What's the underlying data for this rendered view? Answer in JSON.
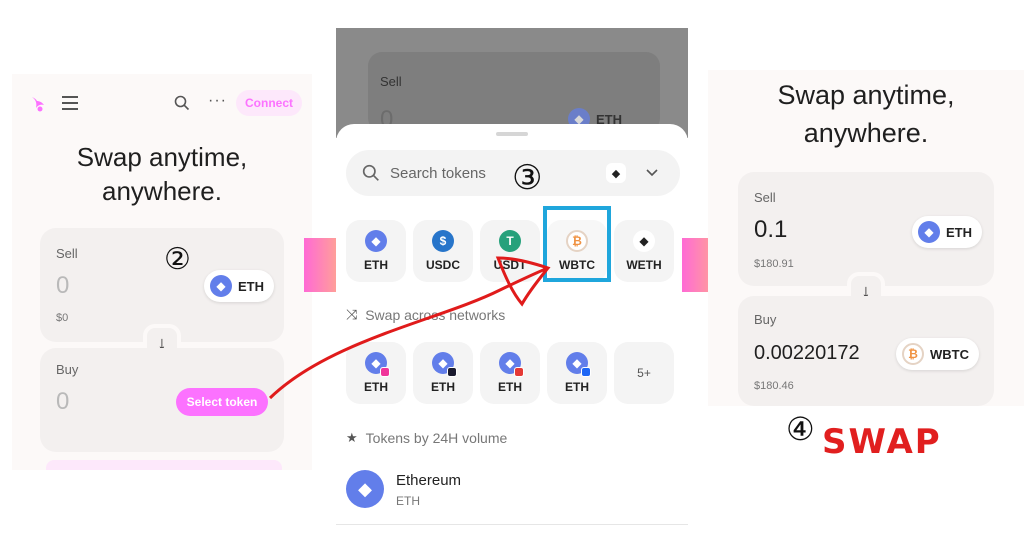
{
  "panel1": {
    "connect_label": "Connect",
    "hero_line1": "Swap anytime,",
    "hero_line2": "anywhere.",
    "sell_label": "Sell",
    "sell_amount": "0",
    "sell_fiat": "$0",
    "sell_token": "ETH",
    "buy_label": "Buy",
    "buy_amount": "0",
    "select_token_label": "Select token"
  },
  "panel2": {
    "bg_sell_label": "Sell",
    "bg_sell_amount": "0",
    "bg_token": "ETH",
    "search_placeholder": "Search tokens",
    "quick_tokens": [
      "ETH",
      "USDC",
      "USDT",
      "WBTC",
      "WETH"
    ],
    "cross_network_label": "Swap across networks",
    "network_tokens": [
      "ETH",
      "ETH",
      "ETH",
      "ETH"
    ],
    "more_networks": "5+",
    "volume_label": "Tokens by 24H volume",
    "list_item_name": "Ethereum",
    "list_item_symbol": "ETH"
  },
  "panel3": {
    "hero_line1": "Swap anytime,",
    "hero_line2": "anywhere.",
    "sell_label": "Sell",
    "sell_amount": "0.1",
    "sell_fiat": "$180.91",
    "sell_token": "ETH",
    "buy_label": "Buy",
    "buy_amount": "0.00220172",
    "buy_fiat": "$180.46",
    "buy_token": "WBTC"
  },
  "annotations": {
    "step2": "②",
    "step3": "③",
    "step4": "④",
    "swap_word": "SWAP",
    "highlight_color": "#1fa6dc",
    "arrow_color": "#e01b1b"
  },
  "colors": {
    "accent_pink": "#fc72ff",
    "connect_bg": "#fde8fb",
    "connect_text": "#fc72ff",
    "chevron_gradient_start": "#ff6ad5",
    "chevron_gradient_end": "#ffc56d"
  }
}
